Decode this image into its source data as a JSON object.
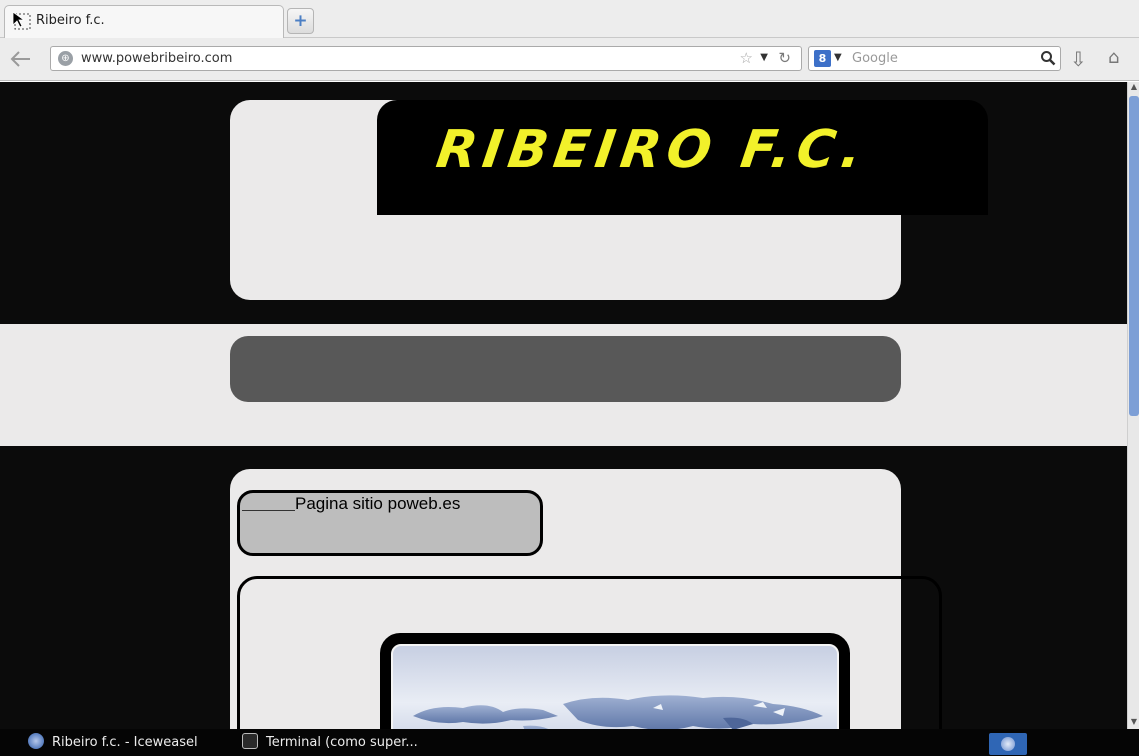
{
  "browser": {
    "tab_title": "Ribeiro f.c.",
    "new_tab_symbol": "+",
    "url": "www.powebribeiro.com",
    "search_engine_icon": "8",
    "search_placeholder": "Google",
    "icons": [
      "back-icon",
      "globe-icon",
      "bookmark-star-icon",
      "reload-icon",
      "google-icon",
      "search-icon",
      "download-icon",
      "home-icon"
    ]
  },
  "page": {
    "logo_text": "RIBEIRO F.C.",
    "pagina_label": "Pagina sitio poweb.es",
    "colors": {
      "background_dark": "#0b0b0b",
      "card": "#ebeaea",
      "nav_pill": "#585858",
      "logo_text": "#f2f12a",
      "pagina_box": "#bdbdbd"
    }
  },
  "taskbar": {
    "items": [
      {
        "label": "Ribeiro f.c. - Iceweasel"
      },
      {
        "label": "Terminal (como super..."
      }
    ]
  }
}
